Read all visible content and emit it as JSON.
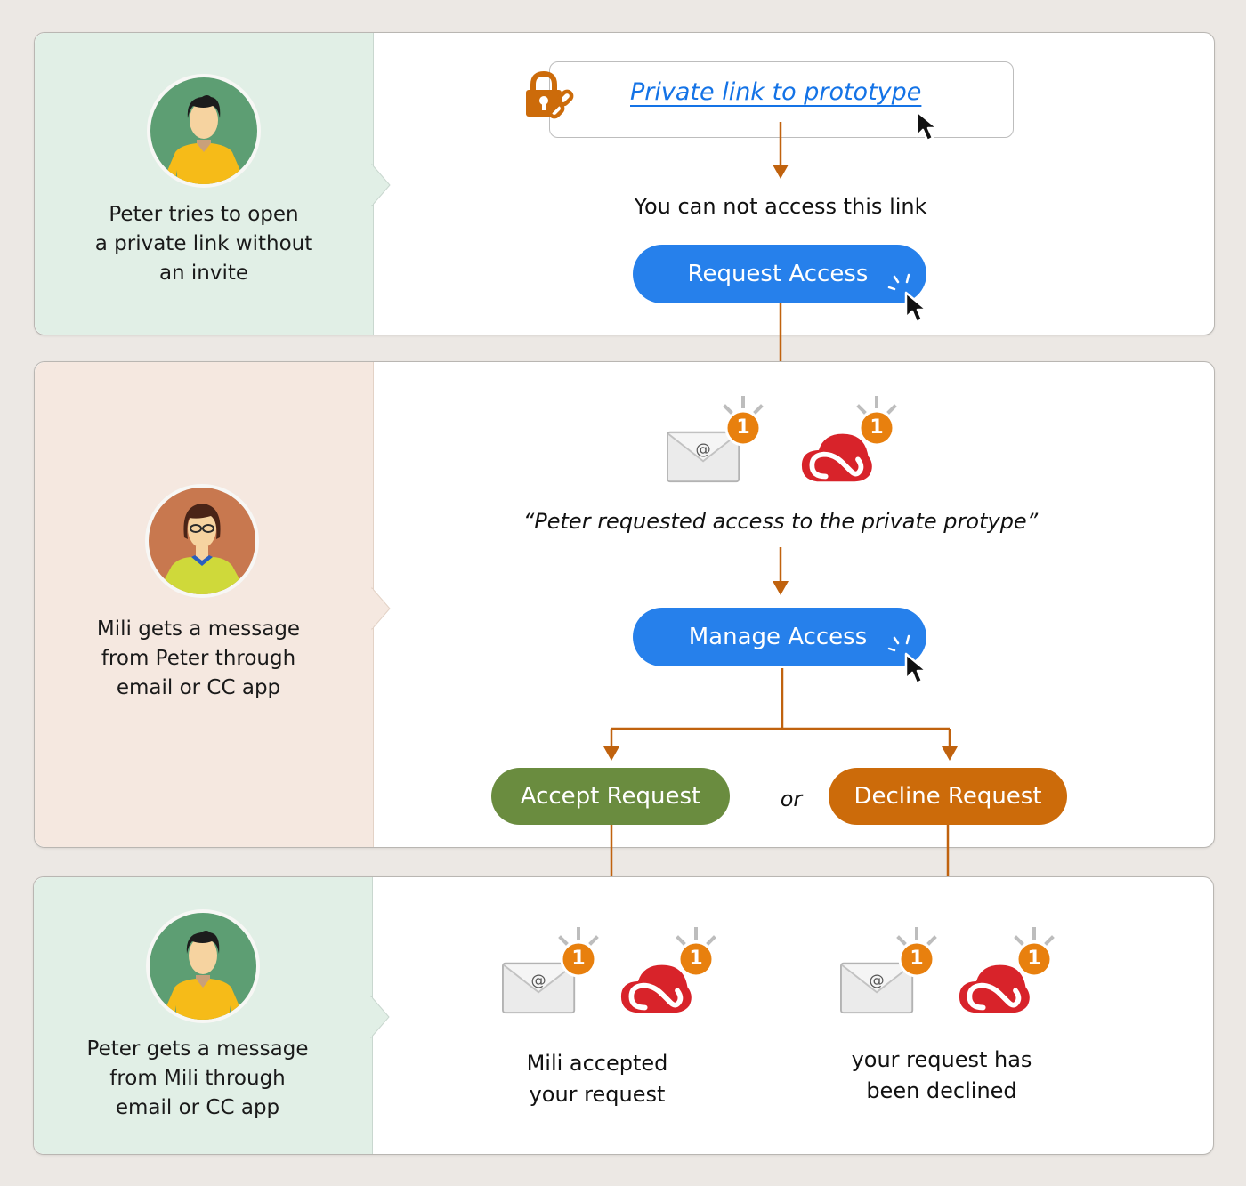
{
  "colors": {
    "background": "#ece8e4",
    "peter_panel": "#e1efe6",
    "mili_panel": "#f5e8e0",
    "link_blue": "#1473e6",
    "button_blue": "#2680eb",
    "accept_green": "#6a8c3f",
    "decline_orange": "#cc6b0a",
    "arrow": "#c0620e",
    "badge_orange": "#e8800e",
    "cc_red": "#d8232a"
  },
  "step1": {
    "actor": "Peter",
    "caption": [
      "Peter tries to open",
      "a private link without",
      "an invite"
    ],
    "lock_icon": "lock-link-icon",
    "link_text": "Private link to prototype",
    "message": "You can not access this link",
    "button_label": "Request Access"
  },
  "step2": {
    "actor": "Mili",
    "caption": [
      "Mili gets a message",
      "from Peter through",
      "email or CC app"
    ],
    "email_badge": "1",
    "cc_badge": "1",
    "notification": "“Peter requested access to the private protype”",
    "manage_label": "Manage Access",
    "accept_label": "Accept Request",
    "or_label": "or",
    "decline_label": "Decline Request"
  },
  "step3": {
    "actor": "Peter",
    "caption": [
      "Peter gets a message",
      "from Mili through",
      "email or CC app"
    ],
    "accepted": {
      "email_badge": "1",
      "cc_badge": "1",
      "text": [
        "Mili accepted",
        "your request"
      ]
    },
    "declined": {
      "email_badge": "1",
      "cc_badge": "1",
      "text": [
        "your request has",
        "been declined"
      ]
    }
  }
}
